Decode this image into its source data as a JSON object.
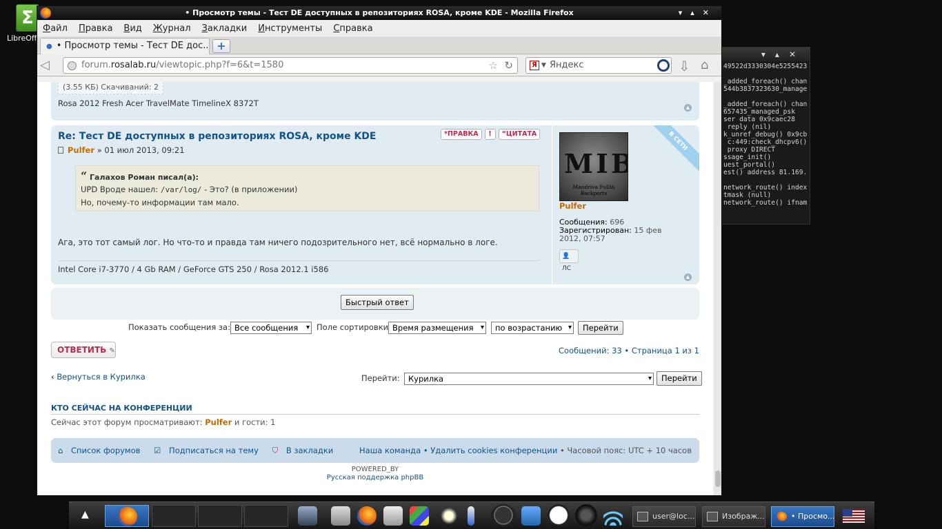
{
  "desktop": {
    "icon_label": "LibreOffice Calc"
  },
  "terminal": {
    "lines": [
      "49522d3330304e5255423",
      "",
      "_added_foreach() chan",
      "544b3837323630_manage",
      "",
      "_added_foreach() chan",
      "657435_managed_psk",
      "ser data 0x9caec28",
      " reply (nil)",
      "k_unref_debug() 0x9cb",
      " c:449:check_dhcpv6()",
      " proxy DIRECT",
      "ssage_init()",
      "uest_portal()",
      "est() address 81.169.",
      "",
      "network_route() index",
      "tmask (null)",
      "network_route() ifnam"
    ]
  },
  "window": {
    "title": "• Просмотр темы - Тест DE доступных в репозиториях ROSA, кроме KDE - Mozilla Firefox"
  },
  "menu": [
    "Файл",
    "Правка",
    "Вид",
    "Журнал",
    "Закладки",
    "Инструменты",
    "Справка"
  ],
  "tab": {
    "label": "• Просмотр темы - Тест DE дос..."
  },
  "urlbar": {
    "prefix": "forum.",
    "domain": "rosalab.ru",
    "path": "/viewtopic.php?f=6&t=1580"
  },
  "searchbar": {
    "placeholder": "Яндекс"
  },
  "post1": {
    "attach": "(3.55 КБ) Скачиваний: 2",
    "signature": "Rosa 2012 Fresh Acer TravelMate TimelineX 8372T"
  },
  "post2": {
    "title": "Re: Тест DE доступных в репозиториях ROSA, кроме KDE",
    "edit_label": "ПРАВКА",
    "quote_label": "ЦИТАТА",
    "author": "Pulfer",
    "date": "» 01 июл 2013, 09:21",
    "quote_author": "Галахов Роман писал(а):",
    "quote_line1_pre": "UPD Вроде нашел: ",
    "quote_line1_code": "/var/log/",
    "quote_line1_post": " - Это? (в приложении)",
    "quote_line2": "Но, почему-то информации там мало.",
    "text": "Ага, это тот самый лог. Но что-то и правда там ничего подозрительного нет, всё нормально в логе.",
    "signature": "Intel Core i7-3770 / 4 Gb RAM / GeForce GTS 250 / Rosa 2012.1 i586",
    "online": "В СЕТИ",
    "avatar_caption": "Mandriva Fullin Backports",
    "profile_name": "Pulfer",
    "messages_label": "Сообщения:",
    "messages": "696",
    "registered_label": "Зарегистрирован:",
    "registered": "15 фев 2012, 07:57",
    "pm_label": "ЛС"
  },
  "quick_reply": "Быстрый ответ",
  "sort": {
    "show_label": "Показать сообщения за:",
    "show_value": "Все сообщения",
    "sort_label": "Поле сортировки",
    "sort_value": "Время размещения",
    "order_value": "по возрастанию",
    "go": "Перейти"
  },
  "reply_button": "ОТВЕТИТЬ",
  "pagination": "Сообщений: 33 • Страница 1 из 1",
  "back_link": "Вернуться в Курилка",
  "jump": {
    "label": "Перейти:",
    "value": "Курилка",
    "go": "Перейти"
  },
  "whos_online": {
    "title": "КТО СЕЙЧАС НА КОНФЕРЕНЦИИ",
    "text_pre": "Сейчас этот форум просматривают: ",
    "user": "Pulfer",
    "text_post": " и гости: 1"
  },
  "footer": {
    "forums": "Список форумов",
    "subscribe": "Подписаться на тему",
    "bookmark": "В закладки",
    "team": "Наша команда",
    "cookies": "Удалить cookies конференции",
    "tz": "Часовой пояс: UTC + 10 часов"
  },
  "powered": {
    "line1": "POWERED_BY",
    "line2": "Русская поддержка phpBB"
  },
  "taskbar": {
    "task1": "user@loc...",
    "task2": "Изображ...",
    "task3": "• Просмо..."
  }
}
